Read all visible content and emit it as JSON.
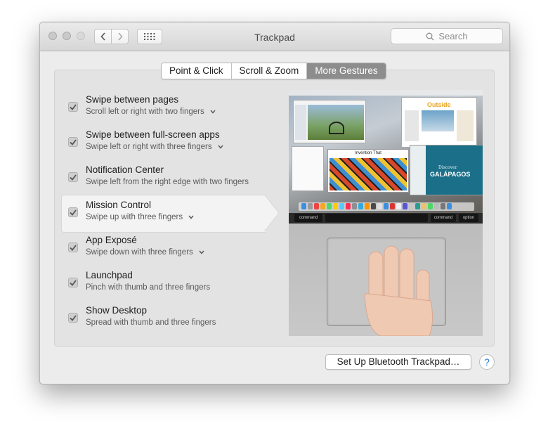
{
  "window": {
    "title": "Trackpad",
    "search_placeholder": "Search"
  },
  "tabs": [
    {
      "label": "Point & Click",
      "selected": false
    },
    {
      "label": "Scroll & Zoom",
      "selected": false
    },
    {
      "label": "More Gestures",
      "selected": true
    }
  ],
  "gestures": [
    {
      "title": "Swipe between pages",
      "subtitle": "Scroll left or right with two fingers",
      "checked": true,
      "has_menu": true
    },
    {
      "title": "Swipe between full-screen apps",
      "subtitle": "Swipe left or right with three fingers",
      "checked": true,
      "has_menu": true
    },
    {
      "title": "Notification Center",
      "subtitle": "Swipe left from the right edge with two fingers",
      "checked": true,
      "has_menu": false
    },
    {
      "title": "Mission Control",
      "subtitle": "Swipe up with three fingers",
      "checked": true,
      "has_menu": true,
      "selected": true
    },
    {
      "title": "App Exposé",
      "subtitle": "Swipe down with three fingers",
      "checked": true,
      "has_menu": true
    },
    {
      "title": "Launchpad",
      "subtitle": "Pinch with thumb and three fingers",
      "checked": true,
      "has_menu": false
    },
    {
      "title": "Show Desktop",
      "subtitle": "Spread with thumb and three fingers",
      "checked": true,
      "has_menu": false
    }
  ],
  "preview": {
    "keys": {
      "command_left": "command",
      "command_right": "command",
      "option": "option"
    },
    "window_text": {
      "magazine": "Outside",
      "title": "Invention That",
      "destination": "GALÁPAGOS",
      "destination_pre": "Discover"
    }
  },
  "footer": {
    "setup_button": "Set Up Bluetooth Trackpad…",
    "help_label": "?"
  },
  "colors": {
    "selected_tab": "#8d8d8d",
    "help_accent": "#2a7bd6"
  }
}
